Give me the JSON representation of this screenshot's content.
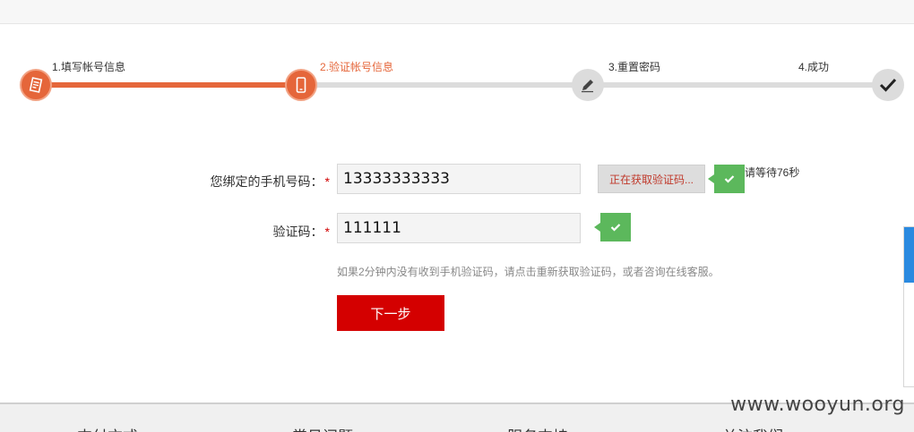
{
  "steps": [
    {
      "label": "1.填写帐号信息",
      "icon": "document-icon",
      "state": "done"
    },
    {
      "label": "2.验证帐号信息",
      "icon": "phone-icon",
      "state": "current"
    },
    {
      "label": "3.重置密码",
      "icon": "pencil-icon",
      "state": "todo"
    },
    {
      "label": "4.成功",
      "icon": "check-icon",
      "state": "todo"
    }
  ],
  "form": {
    "phone_label": "您绑定的手机号码：",
    "phone_value": "13333333333",
    "send_button": "正在获取验证码...",
    "wait_text": "请等待76秒",
    "code_label": "验证码：",
    "code_value": "111111",
    "required_mark": "*",
    "hint": "如果2分钟内没有收到手机验证码，请点击重新获取验证码，或者咨询在线客服。",
    "next_button": "下一步"
  },
  "footer": {
    "items": [
      "支付方式",
      "常见问题",
      "服务支持",
      "关注我们"
    ]
  },
  "watermark": "www.wooyun.org",
  "colors": {
    "accent": "#e5663a",
    "primary_button": "#d40000",
    "success": "#5cb85c",
    "inactive": "#dcdcdc"
  }
}
